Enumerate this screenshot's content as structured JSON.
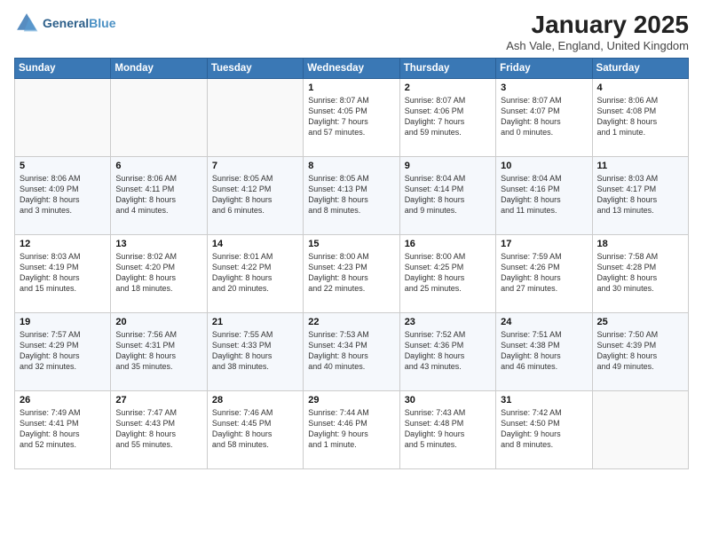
{
  "header": {
    "logo_line1": "General",
    "logo_line2": "Blue",
    "month": "January 2025",
    "location": "Ash Vale, England, United Kingdom"
  },
  "days_of_week": [
    "Sunday",
    "Monday",
    "Tuesday",
    "Wednesday",
    "Thursday",
    "Friday",
    "Saturday"
  ],
  "weeks": [
    [
      {
        "day": "",
        "info": ""
      },
      {
        "day": "",
        "info": ""
      },
      {
        "day": "",
        "info": ""
      },
      {
        "day": "1",
        "info": "Sunrise: 8:07 AM\nSunset: 4:05 PM\nDaylight: 7 hours\nand 57 minutes."
      },
      {
        "day": "2",
        "info": "Sunrise: 8:07 AM\nSunset: 4:06 PM\nDaylight: 7 hours\nand 59 minutes."
      },
      {
        "day": "3",
        "info": "Sunrise: 8:07 AM\nSunset: 4:07 PM\nDaylight: 8 hours\nand 0 minutes."
      },
      {
        "day": "4",
        "info": "Sunrise: 8:06 AM\nSunset: 4:08 PM\nDaylight: 8 hours\nand 1 minute."
      }
    ],
    [
      {
        "day": "5",
        "info": "Sunrise: 8:06 AM\nSunset: 4:09 PM\nDaylight: 8 hours\nand 3 minutes."
      },
      {
        "day": "6",
        "info": "Sunrise: 8:06 AM\nSunset: 4:11 PM\nDaylight: 8 hours\nand 4 minutes."
      },
      {
        "day": "7",
        "info": "Sunrise: 8:05 AM\nSunset: 4:12 PM\nDaylight: 8 hours\nand 6 minutes."
      },
      {
        "day": "8",
        "info": "Sunrise: 8:05 AM\nSunset: 4:13 PM\nDaylight: 8 hours\nand 8 minutes."
      },
      {
        "day": "9",
        "info": "Sunrise: 8:04 AM\nSunset: 4:14 PM\nDaylight: 8 hours\nand 9 minutes."
      },
      {
        "day": "10",
        "info": "Sunrise: 8:04 AM\nSunset: 4:16 PM\nDaylight: 8 hours\nand 11 minutes."
      },
      {
        "day": "11",
        "info": "Sunrise: 8:03 AM\nSunset: 4:17 PM\nDaylight: 8 hours\nand 13 minutes."
      }
    ],
    [
      {
        "day": "12",
        "info": "Sunrise: 8:03 AM\nSunset: 4:19 PM\nDaylight: 8 hours\nand 15 minutes."
      },
      {
        "day": "13",
        "info": "Sunrise: 8:02 AM\nSunset: 4:20 PM\nDaylight: 8 hours\nand 18 minutes."
      },
      {
        "day": "14",
        "info": "Sunrise: 8:01 AM\nSunset: 4:22 PM\nDaylight: 8 hours\nand 20 minutes."
      },
      {
        "day": "15",
        "info": "Sunrise: 8:00 AM\nSunset: 4:23 PM\nDaylight: 8 hours\nand 22 minutes."
      },
      {
        "day": "16",
        "info": "Sunrise: 8:00 AM\nSunset: 4:25 PM\nDaylight: 8 hours\nand 25 minutes."
      },
      {
        "day": "17",
        "info": "Sunrise: 7:59 AM\nSunset: 4:26 PM\nDaylight: 8 hours\nand 27 minutes."
      },
      {
        "day": "18",
        "info": "Sunrise: 7:58 AM\nSunset: 4:28 PM\nDaylight: 8 hours\nand 30 minutes."
      }
    ],
    [
      {
        "day": "19",
        "info": "Sunrise: 7:57 AM\nSunset: 4:29 PM\nDaylight: 8 hours\nand 32 minutes."
      },
      {
        "day": "20",
        "info": "Sunrise: 7:56 AM\nSunset: 4:31 PM\nDaylight: 8 hours\nand 35 minutes."
      },
      {
        "day": "21",
        "info": "Sunrise: 7:55 AM\nSunset: 4:33 PM\nDaylight: 8 hours\nand 38 minutes."
      },
      {
        "day": "22",
        "info": "Sunrise: 7:53 AM\nSunset: 4:34 PM\nDaylight: 8 hours\nand 40 minutes."
      },
      {
        "day": "23",
        "info": "Sunrise: 7:52 AM\nSunset: 4:36 PM\nDaylight: 8 hours\nand 43 minutes."
      },
      {
        "day": "24",
        "info": "Sunrise: 7:51 AM\nSunset: 4:38 PM\nDaylight: 8 hours\nand 46 minutes."
      },
      {
        "day": "25",
        "info": "Sunrise: 7:50 AM\nSunset: 4:39 PM\nDaylight: 8 hours\nand 49 minutes."
      }
    ],
    [
      {
        "day": "26",
        "info": "Sunrise: 7:49 AM\nSunset: 4:41 PM\nDaylight: 8 hours\nand 52 minutes."
      },
      {
        "day": "27",
        "info": "Sunrise: 7:47 AM\nSunset: 4:43 PM\nDaylight: 8 hours\nand 55 minutes."
      },
      {
        "day": "28",
        "info": "Sunrise: 7:46 AM\nSunset: 4:45 PM\nDaylight: 8 hours\nand 58 minutes."
      },
      {
        "day": "29",
        "info": "Sunrise: 7:44 AM\nSunset: 4:46 PM\nDaylight: 9 hours\nand 1 minute."
      },
      {
        "day": "30",
        "info": "Sunrise: 7:43 AM\nSunset: 4:48 PM\nDaylight: 9 hours\nand 5 minutes."
      },
      {
        "day": "31",
        "info": "Sunrise: 7:42 AM\nSunset: 4:50 PM\nDaylight: 9 hours\nand 8 minutes."
      },
      {
        "day": "",
        "info": ""
      }
    ]
  ]
}
